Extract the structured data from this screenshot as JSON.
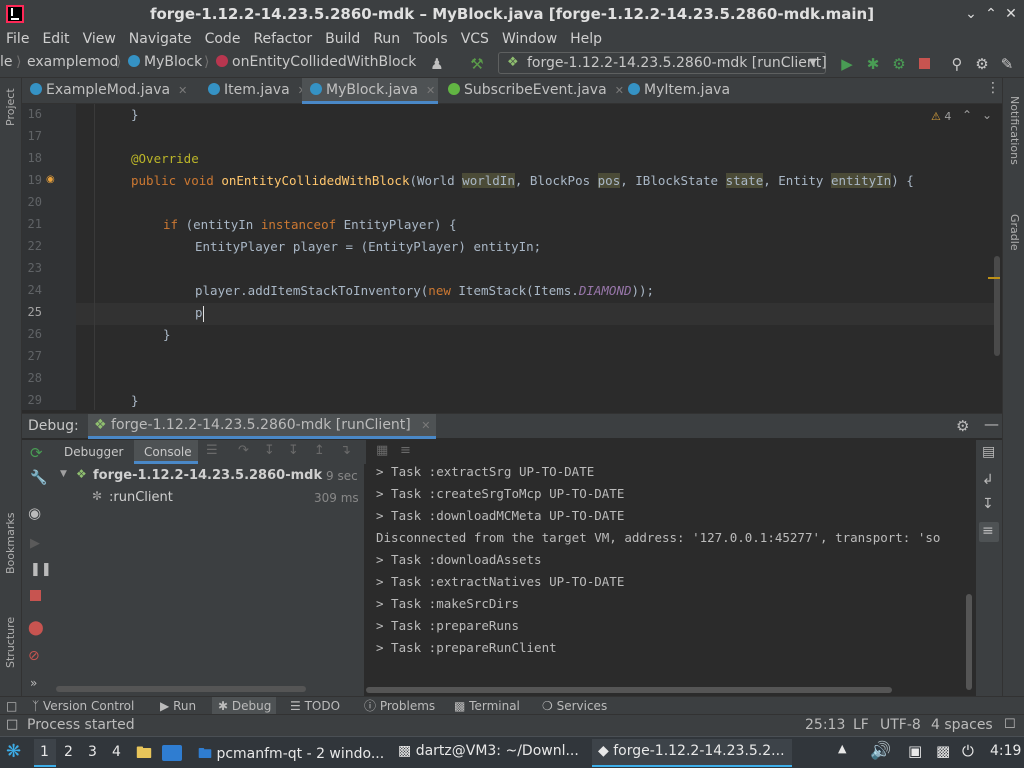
{
  "window": {
    "title": "forge-1.12.2-14.23.5.2860-mdk – MyBlock.java [forge-1.12.2-14.23.5.2860-mdk.main]",
    "icon": "intellij-icon"
  },
  "menu": [
    "File",
    "Edit",
    "View",
    "Navigate",
    "Code",
    "Refactor",
    "Build",
    "Run",
    "Tools",
    "VCS",
    "Window",
    "Help"
  ],
  "breadcrumbs": {
    "partial": "le",
    "module": "examplemod",
    "class": "MyBlock",
    "method": "onEntityCollidedWithBlock"
  },
  "run_config": "forge-1.12.2-14.23.5.2860-mdk [runClient]",
  "side_panels": {
    "left": [
      "Project",
      "Bookmarks",
      "Structure"
    ],
    "right": [
      "Notifications",
      "Gradle"
    ]
  },
  "tabs": [
    {
      "label": "ExampleMod.java",
      "active": false
    },
    {
      "label": "Item.java",
      "active": false
    },
    {
      "label": "MyBlock.java",
      "active": true
    },
    {
      "label": "SubscribeEvent.java",
      "active": false
    },
    {
      "label": "MyItem.java",
      "active": false
    }
  ],
  "warnings_count": "4",
  "editor": {
    "line_numbers": [
      "16",
      "17",
      "18",
      "19",
      "20",
      "21",
      "22",
      "23",
      "24",
      "25",
      "26",
      "27",
      "28",
      "29"
    ],
    "current_line": "25",
    "lines": {
      "l16": "}",
      "l18": "@Override",
      "l19_kw": "public void",
      "l19_fn": "onEntityCollidedWithBlock",
      "l19_a": "(World ",
      "l19_p1": "worldIn",
      "l19_b": ", BlockPos ",
      "l19_p2": "pos",
      "l19_c": ", IBlockState ",
      "l19_p3": "state",
      "l19_d": ", Entity ",
      "l19_p4": "entityIn",
      "l19_e": ") {",
      "l21_a": "if",
      "l21_b": " (entityIn ",
      "l21_c": "instanceof",
      "l21_d": " EntityPlayer) {",
      "l22": "EntityPlayer player = (EntityPlayer) entityIn;",
      "l24_a": "player.addItemStackToInventory(",
      "l24_b": "new",
      "l24_c": " ItemStack(Items.",
      "l24_d": "DIAMOND",
      "l24_e": "));",
      "l25": "p",
      "l26": "}",
      "l29": "}"
    }
  },
  "debug": {
    "label": "Debug:",
    "session": "forge-1.12.2-14.23.5.2860-mdk [runClient]",
    "tabs": [
      "Debugger",
      "Console"
    ],
    "active_tab": "Console",
    "tree": [
      {
        "label": "forge-1.12.2-14.23.5.2860-mdk",
        "time": "9 sec"
      },
      {
        "label": ":runClient",
        "time": "309 ms"
      }
    ],
    "console_lines": [
      "> Task :extractSrg UP-TO-DATE",
      "> Task :createSrgToMcp UP-TO-DATE",
      "> Task :downloadMCMeta UP-TO-DATE",
      "Disconnected from the target VM, address: '127.0.0.1:45277', transport: 'so",
      "> Task :downloadAssets",
      "> Task :extractNatives UP-TO-DATE",
      "> Task :makeSrcDirs",
      "> Task :prepareRuns",
      "> Task :prepareRunClient"
    ]
  },
  "tool_windows": [
    "Version Control",
    "Run",
    "Debug",
    "TODO",
    "Problems",
    "Terminal",
    "Services"
  ],
  "active_tool_window": "Debug",
  "status": {
    "message": "Process started",
    "position": "25:13",
    "line_sep": "LF",
    "encoding": "UTF-8",
    "indent": "4 spaces"
  },
  "taskbar": {
    "desktops": [
      "1",
      "2",
      "3",
      "4"
    ],
    "tasks": [
      {
        "label": "pcmanfm-qt - 2 windo...",
        "active": false
      },
      {
        "label": "dartz@VM3: ~/Downl...",
        "active": false
      },
      {
        "label": "forge-1.12.2-14.23.5.2...",
        "active": true
      }
    ],
    "clock": "4:19"
  },
  "colors": {
    "accent": "#4a88c7",
    "keyword": "#cc7832",
    "annotation": "#bbb529",
    "method": "#ffc66d",
    "constant": "#9876aa",
    "run_green": "#499c54",
    "stop_red": "#c75450"
  }
}
